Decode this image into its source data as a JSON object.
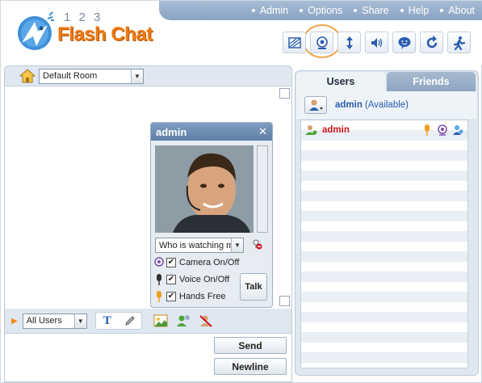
{
  "app": {
    "logo_numbers": "1 2 3",
    "logo_text": "Flash Chat",
    "brand_color": "#ee7a10"
  },
  "topnav": {
    "items": [
      "Admin",
      "Options",
      "Share",
      "Help",
      "About"
    ]
  },
  "toolbar": {
    "icons": [
      "skin-icon",
      "webcam-icon",
      "resize-icon",
      "sound-icon",
      "emoticon-icon",
      "redo-icon",
      "exit-icon"
    ]
  },
  "room": {
    "selected": "Default Room"
  },
  "video": {
    "title": "admin",
    "watching_select": "Who is watching m",
    "camera_label": "Camera On/Off",
    "voice_label": "Voice On/Off",
    "hands_free_label": "Hands Free",
    "talk_label": "Talk",
    "camera_checked": true,
    "voice_checked": true,
    "hands_free_checked": true
  },
  "input": {
    "recipient": "All Users",
    "send_label": "Send",
    "newline_label": "Newline"
  },
  "sidebar": {
    "tabs": [
      "Users",
      "Friends"
    ],
    "active_tab": "Users",
    "status_name": "admin",
    "status_state": "(Available)",
    "users": [
      {
        "name": "admin"
      }
    ]
  }
}
